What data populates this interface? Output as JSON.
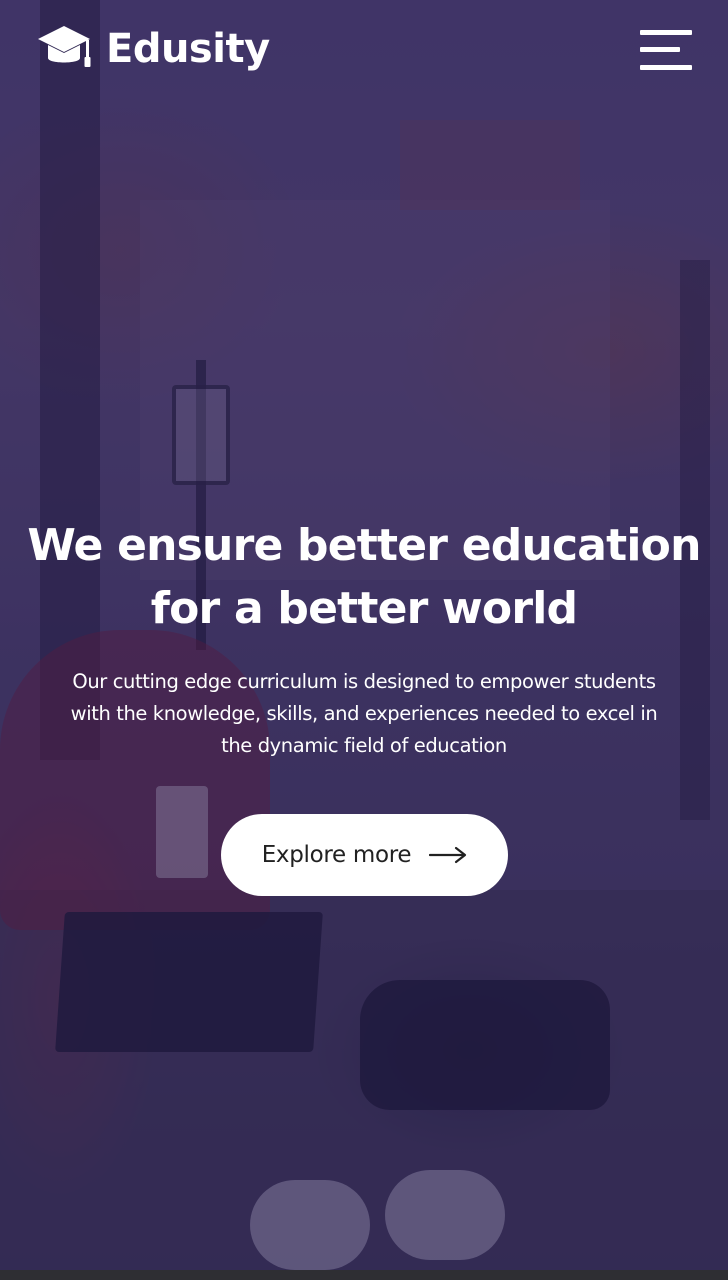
{
  "brand": {
    "name": "Edusity",
    "logo_icon": "graduation-cap-icon"
  },
  "nav": {
    "menu_icon": "hamburger-menu-icon"
  },
  "hero": {
    "headline_line1": "We ensure better education",
    "headline_line2": "for a better world",
    "description_line1": "Our cutting edge curriculum is designed to empower students",
    "description_line2": "with the knowledge, skills, and experiences needed to excel in",
    "description_line3": "the dynamic field of education",
    "cta_label": "Explore more",
    "cta_icon": "arrow-right-icon"
  },
  "colors": {
    "overlay": "#281e5f",
    "text": "#ffffff",
    "button_bg": "#ffffff",
    "button_text": "#212121"
  }
}
